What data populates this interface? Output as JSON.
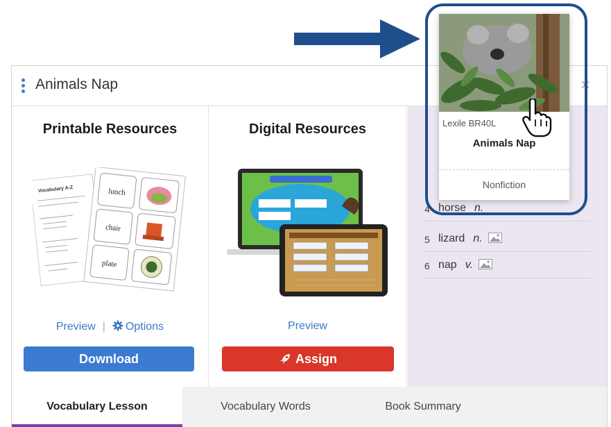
{
  "panel": {
    "title": "Animals Nap",
    "close_glyph": "×"
  },
  "printable": {
    "title": "Printable Resources",
    "preview_label": "Preview",
    "separator": "|",
    "options_label": "Options",
    "download_label": "Download",
    "thumbnail": {
      "worksheet_title": "Vocabulary A-Z",
      "cards": [
        "lunch",
        "chair",
        "plate"
      ]
    }
  },
  "digital": {
    "title": "Digital Resources",
    "preview_label": "Preview",
    "assign_label": "Assign"
  },
  "words": [
    {
      "num": "4",
      "word": "horse",
      "pos": "n.",
      "has_image": false
    },
    {
      "num": "5",
      "word": "lizard",
      "pos": "n.",
      "has_image": true
    },
    {
      "num": "6",
      "word": "nap",
      "pos": "v.",
      "has_image": true
    }
  ],
  "tabs": [
    {
      "label": "Vocabulary Lesson",
      "active": true
    },
    {
      "label": "Vocabulary Words",
      "active": false
    },
    {
      "label": "Book Summary",
      "active": false
    }
  ],
  "book_card": {
    "lexile": "Lexile BR40L",
    "title": "Animals Nap",
    "genre": "Nonfiction"
  },
  "icons": {
    "menu": "kebab-menu-icon",
    "options": "gear-icon",
    "assign": "rocket-icon",
    "word_image": "image-icon",
    "pointer": "hand-pointer-icon",
    "callout_arrow": "arrow-right-icon"
  },
  "colors": {
    "link_blue": "#3b79c6",
    "download_blue": "#3b7bd1",
    "assign_red": "#d8372a",
    "active_tab_purple": "#7b3fa8",
    "callout_navy": "#1f4e8c",
    "words_bg": "#ece6f2"
  }
}
